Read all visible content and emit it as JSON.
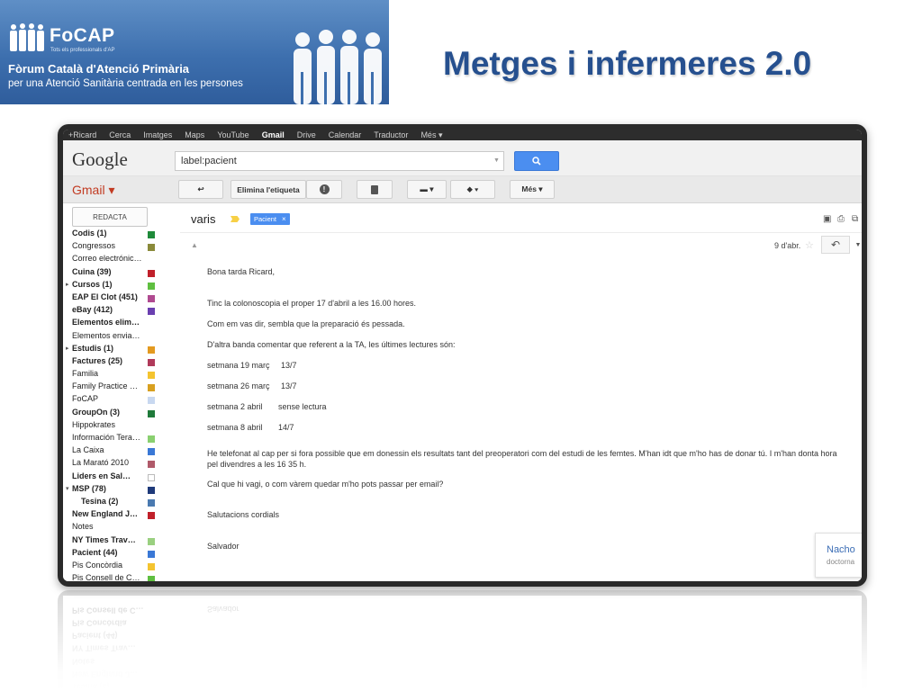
{
  "banner": {
    "logo_text": "FoCAP",
    "logo_sub": "Tots els professionals d'AP",
    "title": "Fòrum Català d'Atenció Primària",
    "subtitle": "per una Atenció Sanitària centrada en les persones"
  },
  "slide_title": "Metges i infermeres 2.0",
  "gmail": {
    "topbar": [
      "+Ricard",
      "Cerca",
      "Imatges",
      "Maps",
      "YouTube",
      "Gmail",
      "Drive",
      "Calendar",
      "Traductor",
      "Més ▾"
    ],
    "topbar_active": "Gmail",
    "logo": "Google",
    "search": {
      "value": "label:pacient"
    },
    "app_label": "Gmail ▾",
    "toolbar": {
      "back": "↩",
      "remove_label": "Elimina l'etiqueta",
      "spam": "!",
      "delete": "🗑",
      "move": "▬ ▾",
      "labels": "⬥ ▾",
      "more": "Més ▾"
    },
    "compose": "REDACTA",
    "labels": [
      {
        "name": "Codis (1)",
        "bold": true,
        "color": "#1f8a3a"
      },
      {
        "name": "Congressos",
        "bold": false,
        "color": "#8a8a3a"
      },
      {
        "name": "Correo electrónic…",
        "bold": false,
        "color": ""
      },
      {
        "name": "Cuina (39)",
        "bold": true,
        "color": "#c0202a"
      },
      {
        "name": "Cursos (1)",
        "bold": true,
        "arrow": true,
        "color": "#5fbf40"
      },
      {
        "name": "EAP El Clot (451)",
        "bold": true,
        "color": "#b04a90"
      },
      {
        "name": "eBay (412)",
        "bold": true,
        "color": "#6a3fb0"
      },
      {
        "name": "Elementos elim…",
        "bold": true,
        "color": ""
      },
      {
        "name": "Elementos envia…",
        "bold": false,
        "color": ""
      },
      {
        "name": "Estudis (1)",
        "bold": true,
        "arrow": true,
        "color": "#e39a20"
      },
      {
        "name": "Factures (25)",
        "bold": true,
        "color": "#b03a5a"
      },
      {
        "name": "Familia",
        "bold": false,
        "color": "#f4c430"
      },
      {
        "name": "Family Practice …",
        "bold": false,
        "color": "#d8a020"
      },
      {
        "name": "FoCAP",
        "bold": false,
        "color": "#c8d8f0"
      },
      {
        "name": "GroupOn (3)",
        "bold": true,
        "color": "#1f7a3a"
      },
      {
        "name": "Hippokrates",
        "bold": false,
        "color": ""
      },
      {
        "name": "Información Tera…",
        "bold": false,
        "color": "#8ad070"
      },
      {
        "name": "La Caixa",
        "bold": false,
        "color": "#3a78d6"
      },
      {
        "name": "La Marató 2010",
        "bold": false,
        "color": "#b05a6a"
      },
      {
        "name": "Liders en Sal…",
        "bold": true,
        "color": "#ffffff"
      },
      {
        "name": "MSP (78)",
        "bold": true,
        "arrow": true,
        "color": "#1f3a7a"
      },
      {
        "name": "Tesina (2)",
        "bold": true,
        "indent": true,
        "color": "#4a7ab0"
      },
      {
        "name": "New England J…",
        "bold": true,
        "color": "#c0202a"
      },
      {
        "name": "Notes",
        "bold": false,
        "color": ""
      },
      {
        "name": "NY Times Trav…",
        "bold": true,
        "color": "#9ad080"
      },
      {
        "name": "Pacient (44)",
        "bold": true,
        "color": "#3a78d6"
      },
      {
        "name": "Pis Concòrdia",
        "bold": false,
        "color": "#f4c430"
      },
      {
        "name": "Pis Consell de C…",
        "bold": false,
        "color": "#5fbf40"
      }
    ],
    "message": {
      "subject": "varis",
      "label_chip": "Pacient",
      "label_chip_close": "×",
      "date": "9 d'abr.",
      "body": [
        "Bona tarda Ricard,",
        "Tinc la colonoscopia el proper 17 d'abril a les 16.00 hores.",
        "Com em vas dir, sembla que la preparació és pessada.",
        "D'altra banda comentar que referent a la TA, les últimes lectures són:",
        "setmana 19 març     13/7",
        "setmana 26 març     13/7",
        "setmana 2 abril       sense lectura",
        "setmana 8 abril       14/7",
        "He telefonat al cap per si fora possible que em donessin els resultats tant del preoperatori com del estudi de les femtes. M'han idt que m'ho has de donar tú. I m'han donta hora pel divendres a les 16 35 h.",
        "Cal que hi vagi, o com vàrem quedar m'ho pots passar per email?",
        "Salutacions cordials",
        "Salvador"
      ]
    },
    "chat": {
      "name": "Nacho",
      "sub": "doctorna"
    }
  },
  "colors": {
    "banner": "#3d6fae",
    "title": "#26508f",
    "search_button": "#4b8ef0",
    "gmail_red": "#c23b22"
  }
}
